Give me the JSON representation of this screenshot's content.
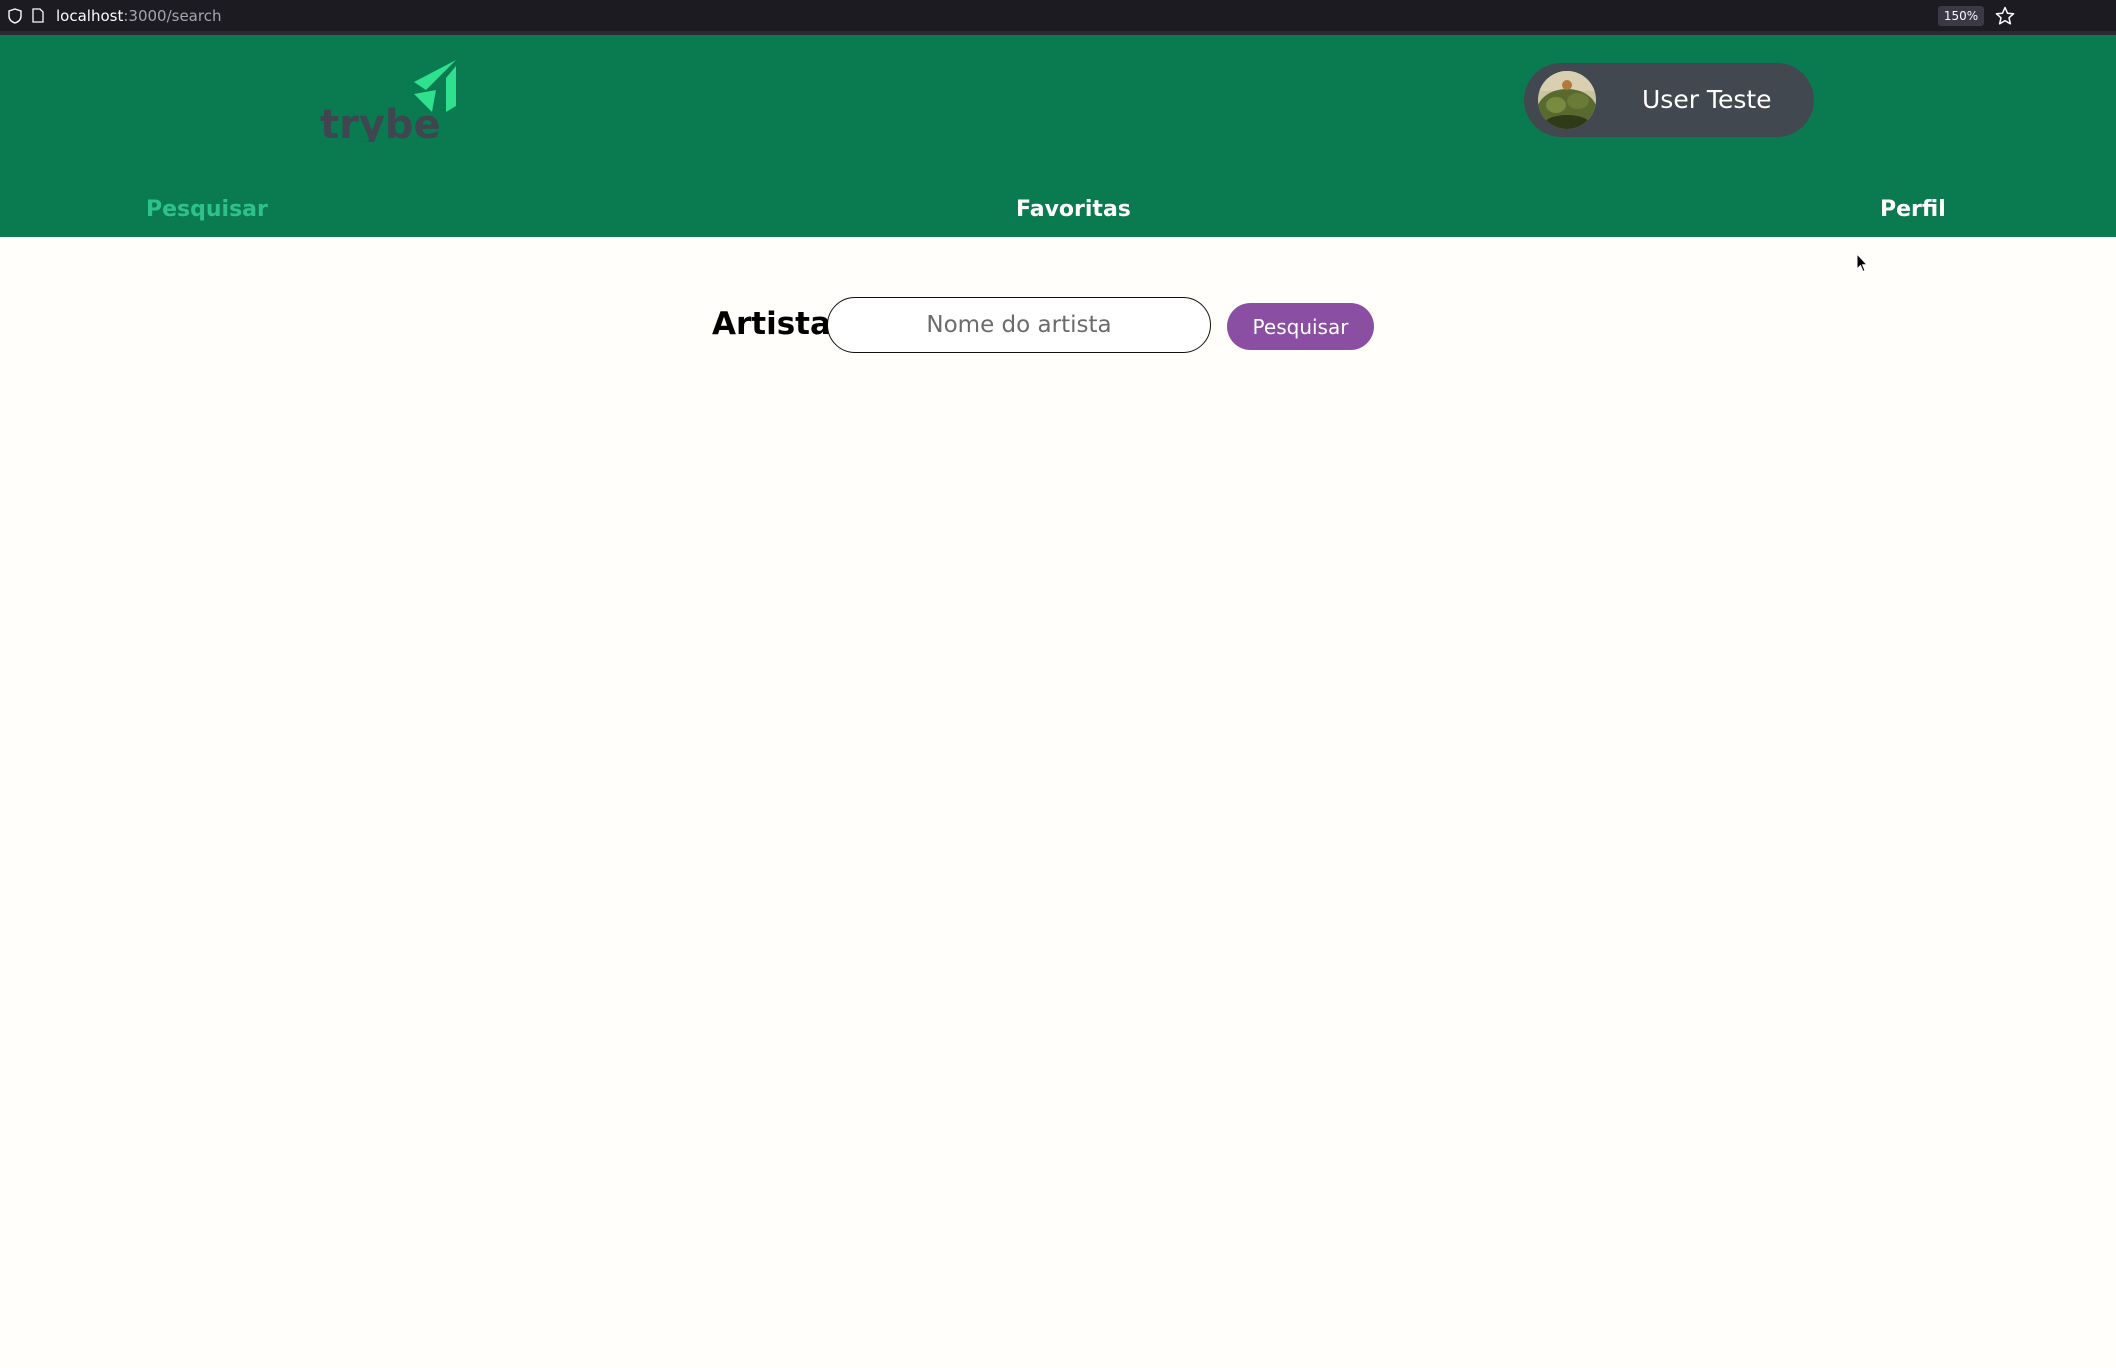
{
  "browser": {
    "url_host": "localhost",
    "url_path": ":3000/search",
    "zoom": "150%"
  },
  "header": {
    "logo_text": "trybe",
    "user": {
      "name": "User Teste"
    }
  },
  "nav": {
    "items": [
      {
        "label": "Pesquisar",
        "active": true
      },
      {
        "label": "Favoritas",
        "active": false
      },
      {
        "label": "Perfil",
        "active": false
      }
    ]
  },
  "search": {
    "label": "Artista",
    "placeholder": "Nome do artista",
    "value": "",
    "button_label": "Pesquisar"
  },
  "colors": {
    "header_bg": "#0a7a50",
    "active_nav": "#2fc18c",
    "button_bg": "#8a4fa3",
    "user_pill_bg": "#424850",
    "page_bg": "#fffefb"
  }
}
